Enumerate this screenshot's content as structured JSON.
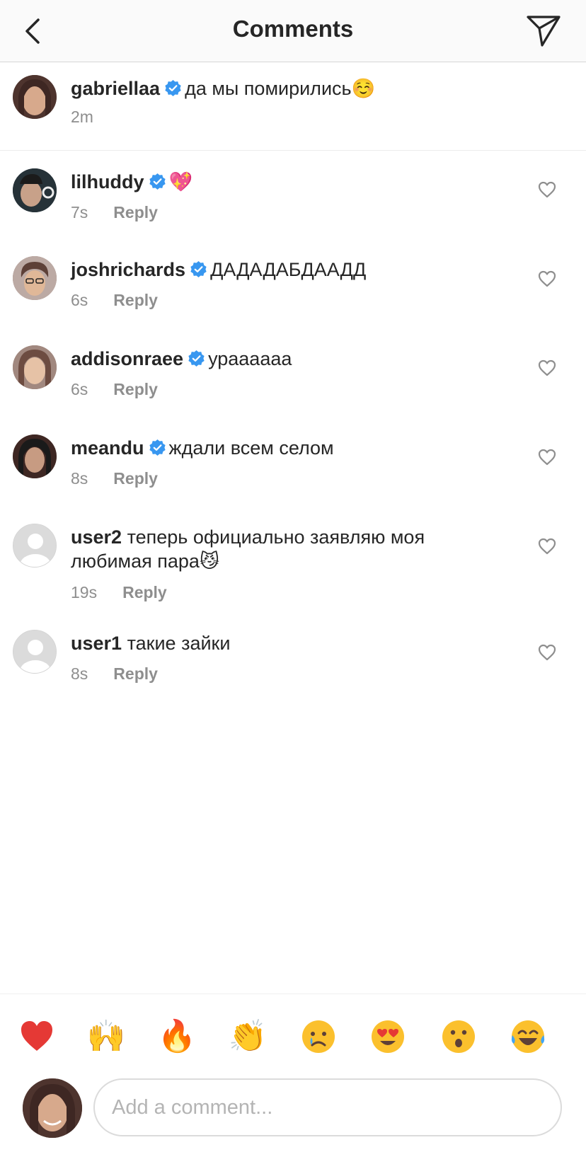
{
  "header": {
    "title": "Comments",
    "back_icon": "chevron-left-icon",
    "send_icon": "paper-plane-icon"
  },
  "caption": {
    "username": "gabriellaa",
    "verified": true,
    "text": "да мы помирились",
    "emoji": "☺️",
    "time": "2m"
  },
  "comments": [
    {
      "username": "lilhuddy",
      "verified": true,
      "text": "",
      "emoji": "💖",
      "time": "7s",
      "reply": "Reply"
    },
    {
      "username": "joshrichards",
      "verified": true,
      "text": "ДАДАДАБДААДД",
      "emoji": "",
      "time": "6s",
      "reply": "Reply"
    },
    {
      "username": "addisonraee",
      "verified": true,
      "text": "ураааааа",
      "emoji": "",
      "time": "6s",
      "reply": "Reply"
    },
    {
      "username": "meandu",
      "verified": true,
      "text": "ждали всем селом",
      "emoji": "",
      "time": "8s",
      "reply": "Reply"
    },
    {
      "username": "user2",
      "verified": false,
      "text": "теперь официально заявляю моя любимая пара",
      "emoji": "😼",
      "time": "19s",
      "reply": "Reply"
    },
    {
      "username": "user1",
      "verified": false,
      "text": "такие зайки",
      "emoji": "",
      "time": "8s",
      "reply": "Reply"
    }
  ],
  "emoji_bar": [
    "❤️",
    "🙌",
    "🔥",
    "👏",
    "😢",
    "😍",
    "😮",
    "😂"
  ],
  "composer": {
    "placeholder": "Add a comment..."
  },
  "colors": {
    "verified_blue": "#3897f0",
    "secondary_text": "#8e8e8e",
    "primary_text": "#262626"
  }
}
